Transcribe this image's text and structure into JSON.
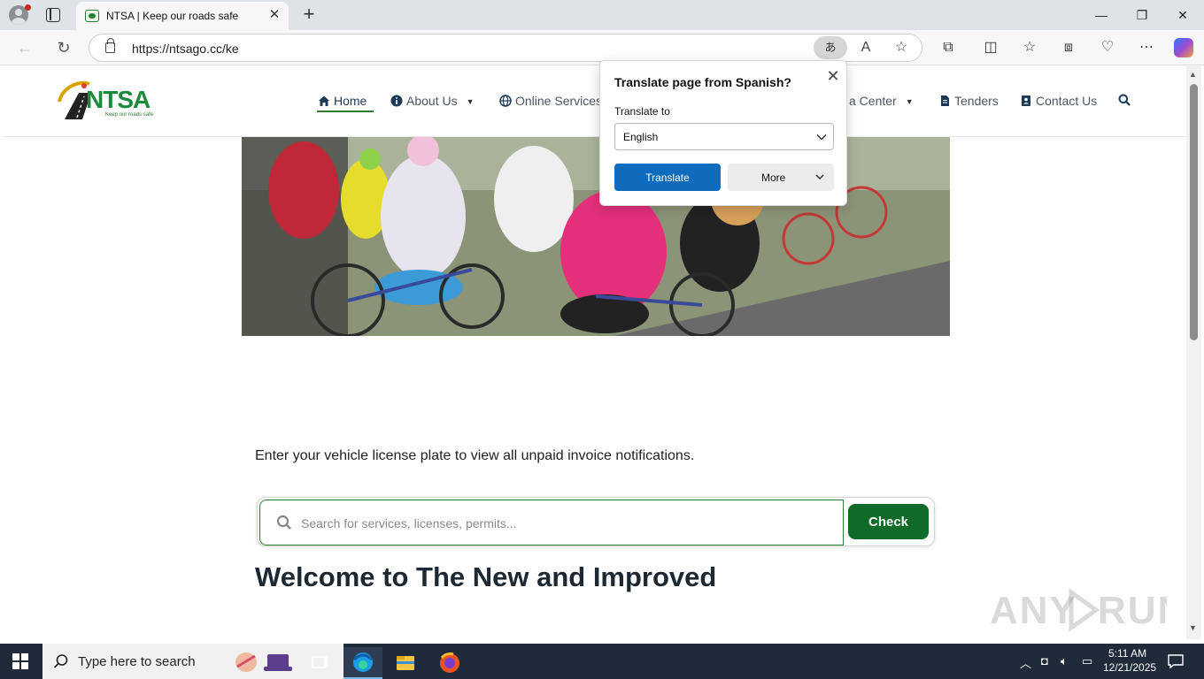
{
  "browser": {
    "tab_title": "NTSA | Keep our roads safe",
    "url": "https://ntsago.cc/ke",
    "translate_icon_glyph": "あ"
  },
  "site": {
    "logo_text": "NTSA",
    "logo_tagline": "Keep our roads safe",
    "nav": {
      "home": "Home",
      "about": "About Us",
      "online_services": "Online Services",
      "media_center_partial": "a Center",
      "tenders": "Tenders",
      "contact": "Contact Us"
    },
    "instructions": "Enter your vehicle license plate to view all unpaid invoice notifications.",
    "search_placeholder": "Search for services, licenses, permits...",
    "check_label": "Check",
    "welcome": "Welcome to The New and Improved"
  },
  "translate_popup": {
    "title": "Translate page from Spanish?",
    "translate_to_label": "Translate to",
    "selected_language": "English",
    "translate_button": "Translate",
    "more_button": "More"
  },
  "taskbar": {
    "search_text": "Type here to search",
    "time": "5:11 AM",
    "date": "12/21/2025"
  },
  "watermark": "ANY RUN",
  "colors": {
    "brand_green": "#0e6b2a",
    "translate_blue": "#0f6cbd",
    "taskbar": "#1f2a3a"
  }
}
